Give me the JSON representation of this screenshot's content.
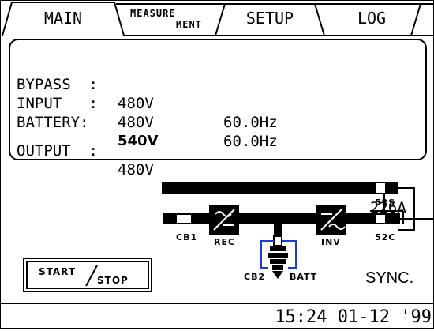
{
  "tabs": {
    "main": "MAIN",
    "measure_top": "MEASURE",
    "measure_bottom": "MENT",
    "setup": "SETUP",
    "log": "LOG"
  },
  "readings": [
    {
      "label": "BYPASS  :",
      "voltage": "480V",
      "frequency": "60.0Hz",
      "current": ""
    },
    {
      "label": "INPUT   :",
      "voltage": "480V",
      "frequency": "60.0Hz",
      "current": ""
    },
    {
      "label": "BATTERY:",
      "voltage": "540V",
      "frequency": "",
      "current": ""
    },
    {
      "label": "OUTPUT  :",
      "voltage": "480V",
      "frequency": "60.0Hz",
      "current": "226A"
    }
  ],
  "diagram": {
    "cb1": "CB1",
    "rec": "REC",
    "cb2": "CB2",
    "batt": "BATT",
    "inv": "INV",
    "52s": "52S",
    "52c": "52C",
    "sync": "SYNC."
  },
  "controls": {
    "start": "START",
    "stop": "STOP"
  },
  "status": {
    "clock": "15:24 01-12 '99"
  }
}
